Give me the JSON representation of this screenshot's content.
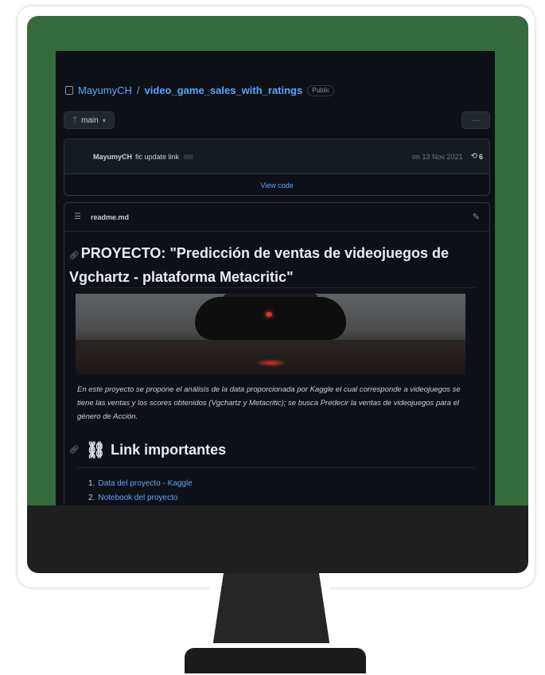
{
  "repo": {
    "owner": "MayumyCH",
    "separator": "/",
    "name": "video_game_sales_with_ratings",
    "visibility": "Public"
  },
  "toolbar": {
    "branch": "main",
    "more": "···"
  },
  "commit": {
    "author": "MayumyCH",
    "message": "fic update link",
    "date": "on 13 Nov 2021",
    "history_count": "6",
    "view_code": "View code"
  },
  "readme": {
    "filename": "readme.md",
    "title": "PROYECTO: \"Predicción de ventas de videojuegos de Vgchartz - plataforma Metacritic\"",
    "description": "En este proyecto se propone el análisis de la data proporcionada por Kaggle el cual corresponde a videojuegos se tiene las ventas y los scores obtenidos (Vgchartz y Metacritic); se busca Predecir la ventas de videojuegos para el género de Acción.",
    "links_heading": "Link importantes",
    "links": [
      {
        "num": "1.",
        "label": "Data del proyecto - Kaggle"
      },
      {
        "num": "2.",
        "label": "Notebook del proyecto"
      }
    ]
  },
  "colors": {
    "screen_bg": "#356b3c",
    "page_bg": "#0d1117",
    "link": "#58a6ff"
  }
}
